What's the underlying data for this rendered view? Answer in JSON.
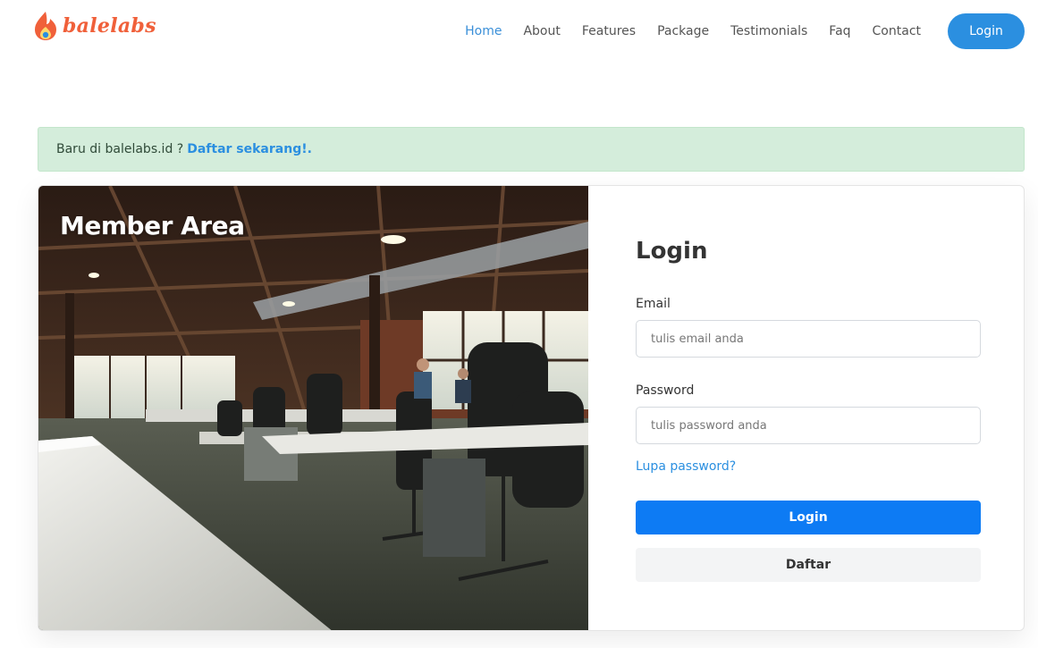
{
  "brand": {
    "name": "balelabs",
    "logo_icon": "flame-icon",
    "color": "#f0603a"
  },
  "nav": {
    "items": [
      {
        "label": "Home",
        "active": true
      },
      {
        "label": "About"
      },
      {
        "label": "Features"
      },
      {
        "label": "Package"
      },
      {
        "label": "Testimonials"
      },
      {
        "label": "Faq"
      },
      {
        "label": "Contact"
      }
    ],
    "login_label": "Login"
  },
  "alert": {
    "text": "Baru di balelabs.id ?",
    "link_label": "Daftar sekarang!."
  },
  "hero": {
    "title": "Member Area"
  },
  "form": {
    "title": "Login",
    "email_label": "Email",
    "email_placeholder": "tulis email anda",
    "password_label": "Password",
    "password_placeholder": "tulis password anda",
    "forgot_label": "Lupa password?",
    "submit_label": "Login",
    "register_label": "Daftar"
  },
  "colors": {
    "accent": "#2b8fe0",
    "primary_button": "#0d7bf4",
    "alert_bg": "#d4eddb"
  }
}
